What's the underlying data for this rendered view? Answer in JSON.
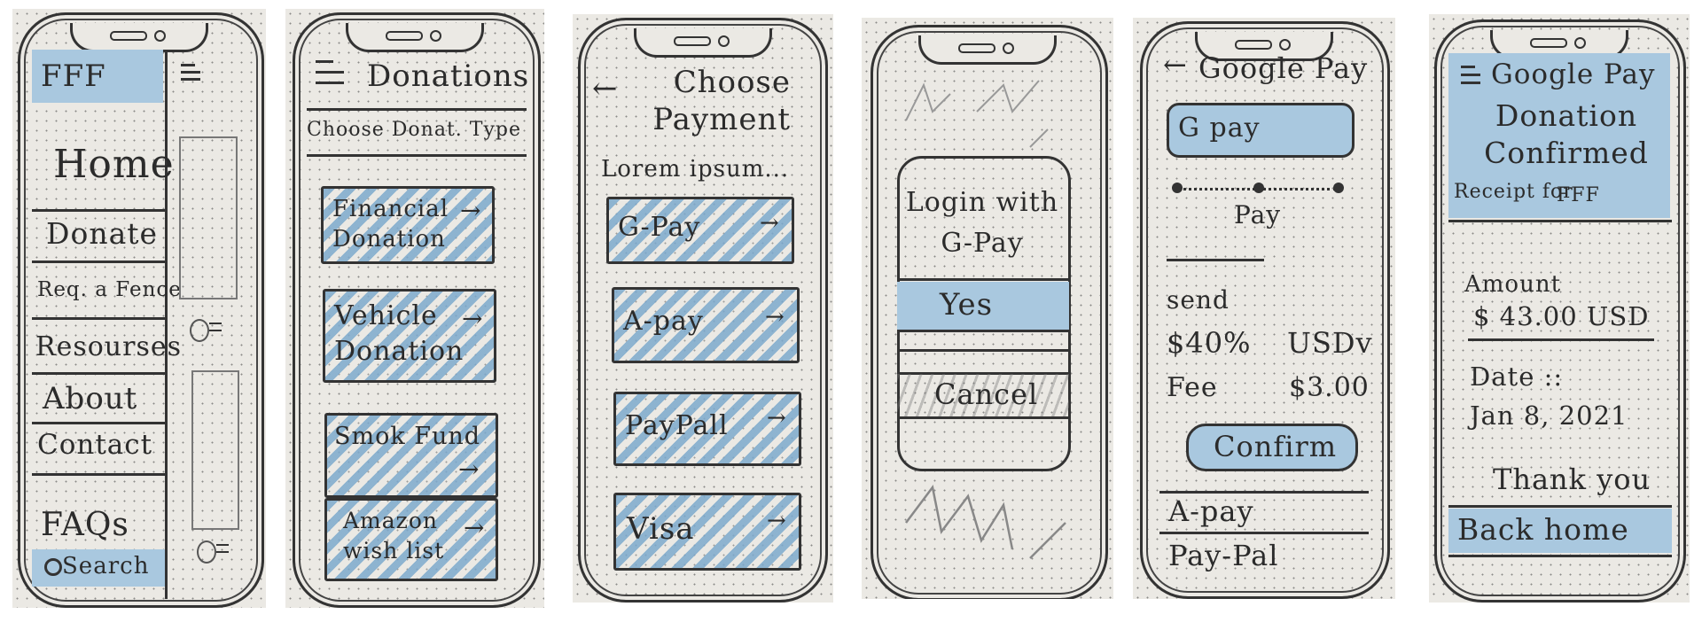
{
  "screens": [
    {
      "logo": "FFF",
      "menu_items": [
        "Home",
        "Donate",
        "Req. a Fence",
        "Resourses",
        "About",
        "Contact",
        "FAQs"
      ],
      "search": "Search"
    },
    {
      "title": "Donations",
      "subtitle": "Choose Donat. Type",
      "options": [
        "Financial Donation",
        "Vehicle Donation",
        "Smok Fund",
        "Amazon wish list"
      ]
    },
    {
      "title": "Choose Payment",
      "intro": "Lorem ipsum...",
      "options": [
        "G-Pay",
        "A-pay",
        "PayPall",
        "Visa"
      ]
    },
    {
      "dialog_title": "Login with G-Pay",
      "yes": "Yes",
      "cancel": "Cancel"
    },
    {
      "title": "Google Pay",
      "gpay": "G pay",
      "pay": "Pay",
      "send_label": "send",
      "amount": "$40%",
      "currency": "USDv",
      "fee_label": "Fee",
      "fee_value": "$3.00",
      "confirm": "Confirm",
      "alt_options": [
        "A-pay",
        "Pay-Pal"
      ]
    },
    {
      "header": "Google Pay",
      "title": "Donation Confirmed",
      "receipt_label": "Receipt for",
      "receipt_org": "FFF",
      "amount_label": "Amount",
      "amount_value": "$ 43.00 USD",
      "date_label": "Date ::",
      "date_value": "Jan 8, 2021",
      "thanks": "Thank you",
      "back": "Back home"
    }
  ],
  "colors": {
    "paper": "#ebe9e4",
    "pencil": "#2b2b2b",
    "blue": "#a9c8df"
  }
}
